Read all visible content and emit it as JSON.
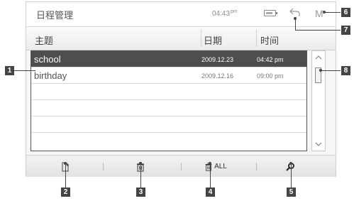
{
  "titlebar": {
    "title": "日程管理",
    "clock": "04:43",
    "clock_ampm": "pm",
    "menu_letter": "M"
  },
  "columns": {
    "subject": "主题",
    "date": "日期",
    "time": "时间"
  },
  "rows": [
    {
      "name": "school",
      "date": "2009.12.23",
      "time": "04:42 pm",
      "selected": true
    },
    {
      "name": "birthday",
      "date": "2009.12.16",
      "time": "09:00 pm",
      "selected": false
    },
    {
      "name": "",
      "date": "",
      "time": ""
    },
    {
      "name": "",
      "date": "",
      "time": ""
    },
    {
      "name": "",
      "date": "",
      "time": ""
    },
    {
      "name": "",
      "date": "",
      "time": ""
    }
  ],
  "toolbar": {
    "delete_all_label": "ALL"
  },
  "callouts": [
    "1",
    "2",
    "3",
    "4",
    "5",
    "6",
    "7",
    "8"
  ],
  "icons": [
    "battery-icon",
    "back-icon",
    "scroll-up-icon",
    "scroll-down-icon",
    "add-schedule-icon",
    "delete-icon",
    "delete-all-icon",
    "search-icon"
  ]
}
